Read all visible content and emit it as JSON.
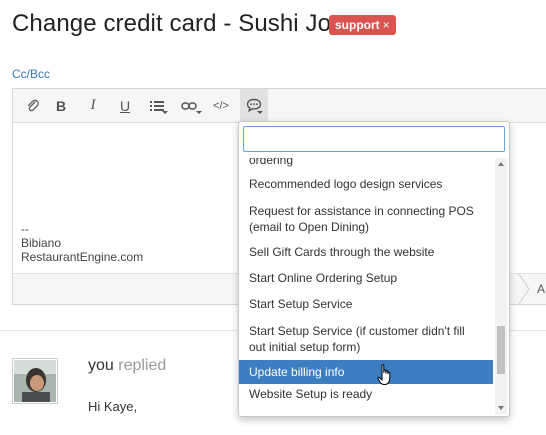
{
  "header": {
    "title": "Change credit card - Sushi Joa",
    "tag": "support",
    "tag_close": "×"
  },
  "cc_link": "Cc/Bcc",
  "toolbar": {
    "icons": [
      "attachment-icon",
      "bold-icon",
      "italic-icon",
      "underline-icon",
      "list-icon",
      "link-icon",
      "code-icon",
      "saved-reply-icon"
    ],
    "bold_label": "B",
    "italic_label": "I",
    "underline_label": "U",
    "code_label": "</>"
  },
  "signature": {
    "dash": "--",
    "name": "Bibiano",
    "site": "RestaurantEngine.com"
  },
  "editor_footer": {
    "label": "A"
  },
  "dropdown": {
    "search_value": "",
    "items": [
      {
        "line1": "ordering",
        "line2": ""
      },
      {
        "line1": "Recommended logo design services",
        "line2": ""
      },
      {
        "line1": "Request for assistance in connecting POS",
        "line2": "(email to Open Dining)"
      },
      {
        "line1": "Sell Gift Cards through the website",
        "line2": ""
      },
      {
        "line1": "Start Online Ordering Setup",
        "line2": ""
      },
      {
        "line1": "Start Setup Service",
        "line2": ""
      },
      {
        "line1": "Start Setup Service (if customer didn't fill",
        "line2": "out initial setup form)"
      },
      {
        "line1": "Update billing info",
        "line2": ""
      },
      {
        "line1": "Website Setup is ready",
        "line2": ""
      }
    ],
    "selected_index": 7,
    "scroll_position": 0.85
  },
  "reply": {
    "author": "you",
    "action": "replied",
    "greeting": "Hi Kaye,"
  },
  "colors": {
    "tag": "#d9534f",
    "link": "#3a78b7",
    "selected": "#3d7ec1"
  }
}
